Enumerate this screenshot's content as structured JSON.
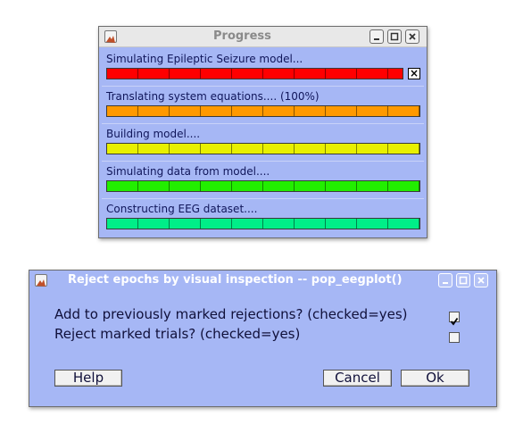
{
  "progress_window": {
    "title": "Progress",
    "stop_label": "×",
    "tasks": [
      {
        "label": "Simulating Epileptic Seizure model...",
        "color": "#ff0000"
      },
      {
        "label": "Translating system equations.... (100%)",
        "color": "#ff9900"
      },
      {
        "label": "Building model....",
        "color": "#e8f000"
      },
      {
        "label": "Simulating data from model....",
        "color": "#22ee00"
      },
      {
        "label": "Constructing EEG dataset....",
        "color": "#00ee88"
      }
    ]
  },
  "reject_window": {
    "title": "Reject epochs by visual inspection -- pop_eegplot()",
    "questions": [
      {
        "label": "Add to previously marked rejections? (checked=yes)",
        "checked": true
      },
      {
        "label": "Reject marked trials? (checked=yes)",
        "checked": false
      }
    ],
    "buttons": {
      "help": "Help",
      "cancel": "Cancel",
      "ok": "Ok"
    }
  },
  "icons": [
    "matlab-icon",
    "minimize-icon",
    "maximize-icon",
    "close-icon",
    "checkmark-icon"
  ]
}
